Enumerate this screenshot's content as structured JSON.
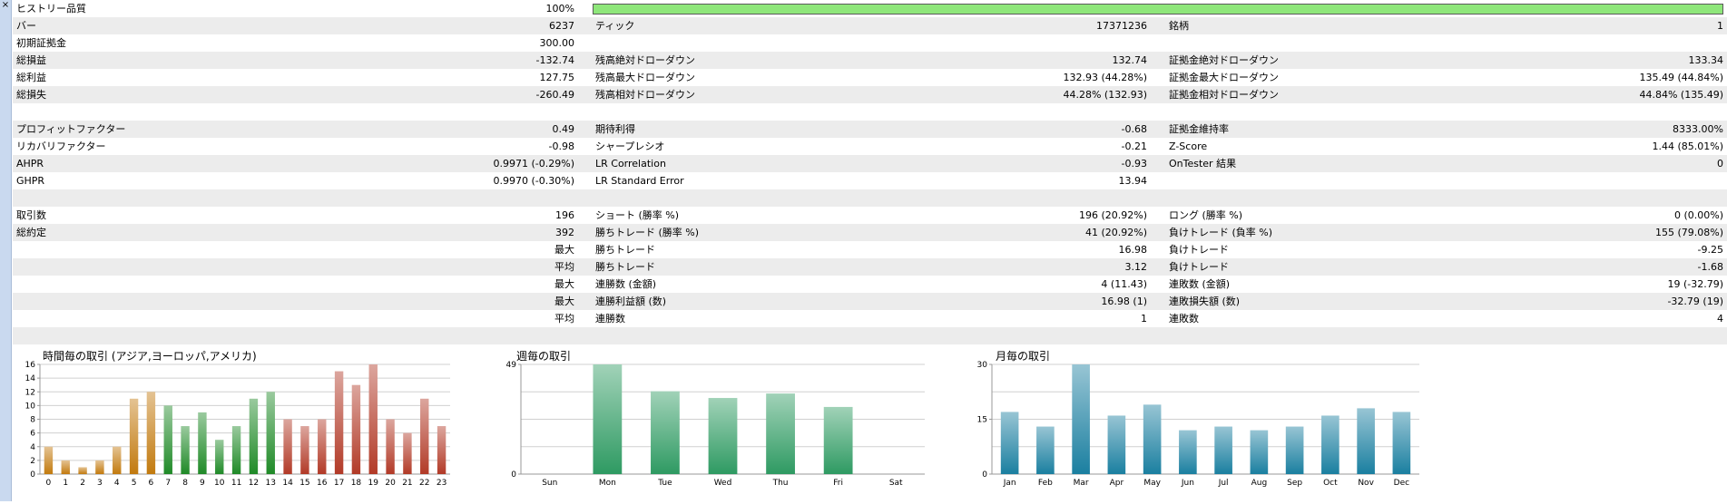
{
  "window": {
    "close_glyph": "×"
  },
  "history_quality": {
    "label": "ヒストリー品質",
    "value": "100%",
    "percent": 100
  },
  "rows": [
    {
      "alt": true,
      "l1": "バー",
      "v1": "6237",
      "l2": "ティック",
      "v2": "17371236",
      "l3": "銘柄",
      "v3": "1"
    },
    {
      "alt": false,
      "l1": "初期証拠金",
      "v1": "300.00",
      "l2": "",
      "v2": "",
      "l3": "",
      "v3": ""
    },
    {
      "alt": true,
      "l1": "総損益",
      "v1": "-132.74",
      "l2": "残高絶対ドローダウン",
      "v2": "132.74",
      "l3": "証拠金絶対ドローダウン",
      "v3": "133.34"
    },
    {
      "alt": false,
      "l1": "総利益",
      "v1": "127.75",
      "l2": "残高最大ドローダウン",
      "v2": "132.93 (44.28%)",
      "l3": "証拠金最大ドローダウン",
      "v3": "135.49 (44.84%)"
    },
    {
      "alt": true,
      "l1": "総損失",
      "v1": "-260.49",
      "l2": "残高相対ドローダウン",
      "v2": "44.28% (132.93)",
      "l3": "証拠金相対ドローダウン",
      "v3": "44.84% (135.49)"
    },
    {
      "alt": false,
      "l1": "",
      "v1": "",
      "l2": "",
      "v2": "",
      "l3": "",
      "v3": ""
    },
    {
      "alt": true,
      "l1": "プロフィットファクター",
      "v1": "0.49",
      "l2": "期待利得",
      "v2": "-0.68",
      "l3": "証拠金維持率",
      "v3": "8333.00%"
    },
    {
      "alt": false,
      "l1": "リカバリファクター",
      "v1": "-0.98",
      "l2": "シャープレシオ",
      "v2": "-0.21",
      "l3": "Z-Score",
      "v3": "1.44 (85.01%)"
    },
    {
      "alt": true,
      "l1": "AHPR",
      "v1": "0.9971 (-0.29%)",
      "l2": "LR Correlation",
      "v2": "-0.93",
      "l3": "OnTester 結果",
      "v3": "0"
    },
    {
      "alt": false,
      "l1": "GHPR",
      "v1": "0.9970 (-0.30%)",
      "l2": "LR Standard Error",
      "v2": "13.94",
      "l3": "",
      "v3": ""
    },
    {
      "alt": true,
      "l1": "",
      "v1": "",
      "l2": "",
      "v2": "",
      "l3": "",
      "v3": ""
    },
    {
      "alt": false,
      "l1": "取引数",
      "v1": "196",
      "l2": "ショート (勝率 %)",
      "v2": "196 (20.92%)",
      "l3": "ロング (勝率 %)",
      "v3": "0 (0.00%)"
    },
    {
      "alt": true,
      "l1": "総約定",
      "v1": "392",
      "l2": "勝ちトレード (勝率 %)",
      "v2": "41 (20.92%)",
      "l3": "負けトレード (負率 %)",
      "v3": "155 (79.08%)"
    },
    {
      "alt": false,
      "l1": "",
      "v1": "最大",
      "l2": "勝ちトレード",
      "v2": "16.98",
      "l3": "負けトレード",
      "v3": "-9.25"
    },
    {
      "alt": true,
      "l1": "",
      "v1": "平均",
      "l2": "勝ちトレード",
      "v2": "3.12",
      "l3": "負けトレード",
      "v3": "-1.68"
    },
    {
      "alt": false,
      "l1": "",
      "v1": "最大",
      "l2": "連勝数 (金額)",
      "v2": "4 (11.43)",
      "l3": "連敗数 (金額)",
      "v3": "19 (-32.79)"
    },
    {
      "alt": true,
      "l1": "",
      "v1": "最大",
      "l2": "連勝利益額 (数)",
      "v2": "16.98 (1)",
      "l3": "連敗損失額 (数)",
      "v3": "-32.79 (19)"
    },
    {
      "alt": false,
      "l1": "",
      "v1": "平均",
      "l2": "連勝数",
      "v2": "1",
      "l3": "連敗数",
      "v3": "4"
    },
    {
      "alt": true,
      "l1": "",
      "v1": "",
      "l2": "",
      "v2": "",
      "l3": "",
      "v3": ""
    }
  ],
  "chart_data": [
    {
      "type": "bar",
      "title": "時間毎の取引 (アジア,ヨーロッパ,アメリカ)",
      "categories": [
        "0",
        "1",
        "2",
        "3",
        "4",
        "5",
        "6",
        "7",
        "8",
        "9",
        "10",
        "11",
        "12",
        "13",
        "14",
        "15",
        "16",
        "17",
        "18",
        "19",
        "20",
        "21",
        "22",
        "23"
      ],
      "values": [
        4,
        2,
        1,
        2,
        4,
        11,
        12,
        10,
        7,
        9,
        5,
        7,
        11,
        12,
        8,
        7,
        8,
        15,
        13,
        16,
        8,
        6,
        11,
        7
      ],
      "y_ticks": [
        "0",
        "2",
        "4",
        "6",
        "8",
        "10",
        "12",
        "14",
        "16"
      ],
      "ylim": [
        0,
        16
      ],
      "grid": true,
      "colors": {
        "asia": "#c27a0e",
        "europe": "#1f8a27",
        "america": "#b23a27"
      }
    },
    {
      "type": "bar",
      "title": "週毎の取引",
      "categories": [
        "Sun",
        "Mon",
        "Tue",
        "Wed",
        "Thu",
        "Fri",
        "Sat"
      ],
      "values": [
        0,
        49,
        37,
        34,
        36,
        30,
        0
      ],
      "y_ticks": [
        "0",
        "49"
      ],
      "ylim": [
        0,
        49
      ],
      "grid": true,
      "colors": {
        "bar": "#2e9a62"
      }
    },
    {
      "type": "bar",
      "title": "月毎の取引",
      "categories": [
        "Jan",
        "Feb",
        "Mar",
        "Apr",
        "May",
        "Jun",
        "Jul",
        "Aug",
        "Sep",
        "Oct",
        "Nov",
        "Dec"
      ],
      "values": [
        17,
        13,
        30,
        16,
        19,
        12,
        13,
        12,
        13,
        16,
        18,
        17
      ],
      "y_ticks": [
        "0",
        "15",
        "30"
      ],
      "ylim": [
        0,
        30
      ],
      "grid": true,
      "colors": {
        "bar": "#1a7fa0"
      }
    }
  ]
}
